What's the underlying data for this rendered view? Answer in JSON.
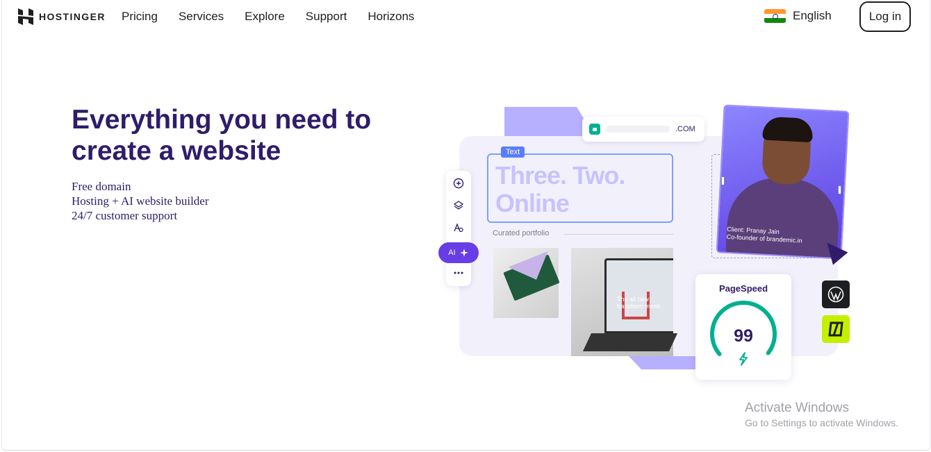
{
  "header": {
    "logo_text": "HOSTINGER",
    "nav": [
      "Pricing",
      "Services",
      "Explore",
      "Support",
      "Horizons"
    ],
    "language": "English",
    "login_label": "Log in"
  },
  "hero": {
    "title": "Everything you need to create a website",
    "features": [
      "Free domain",
      "Hosting + AI website builder",
      "24/7 customer support"
    ]
  },
  "illustration": {
    "url_suffix": ".COM",
    "text_tag": "Text",
    "headline": "Three. Two. Online",
    "curated_label": "Curated portfolio",
    "ai_label": "AI",
    "laptop_text": "The all new transform mesh",
    "client_line1": "Client: Pranay Jain",
    "client_line2": "Co-founder of brandemic.in",
    "pagespeed_label": "PageSpeed",
    "pagespeed_score": "99",
    "pagespeed_fraction": 0.99,
    "accent_color": "#673de6",
    "gauge_color": "#00b090"
  },
  "watermark": {
    "line1": "Activate Windows",
    "line2": "Go to Settings to activate Windows."
  }
}
